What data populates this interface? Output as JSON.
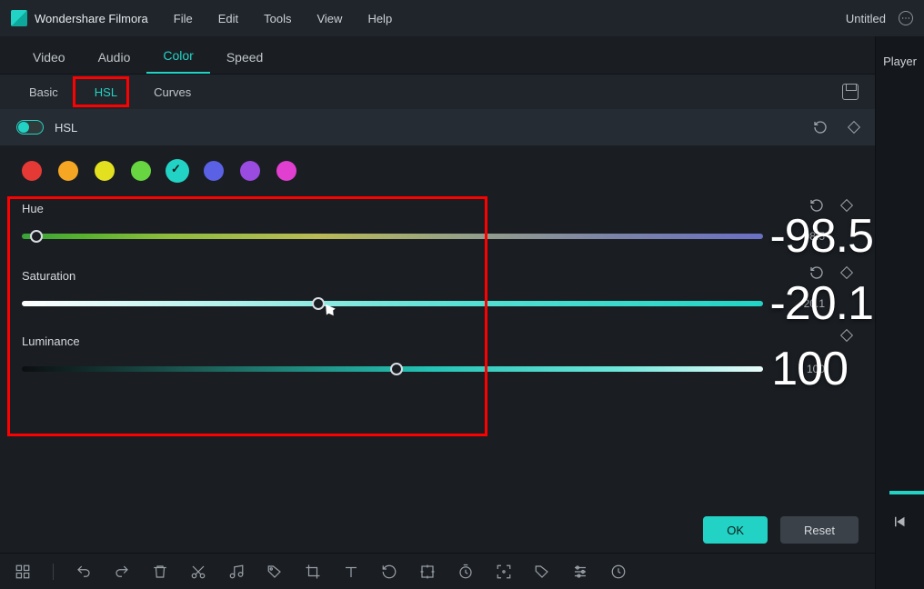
{
  "titlebar": {
    "app_name": "Wondershare Filmora",
    "menu": [
      "File",
      "Edit",
      "Tools",
      "View",
      "Help"
    ],
    "project": "Untitled"
  },
  "tabs": {
    "items": [
      "Video",
      "Audio",
      "Color",
      "Speed"
    ],
    "active": "Color"
  },
  "subtabs": {
    "items": [
      "Basic",
      "HSL",
      "Curves"
    ],
    "active": "HSL"
  },
  "hsl_section": {
    "label": "HSL",
    "enabled": true
  },
  "swatches": [
    {
      "name": "red",
      "color": "#e53935"
    },
    {
      "name": "orange",
      "color": "#f5a623"
    },
    {
      "name": "yellow",
      "color": "#e3e020"
    },
    {
      "name": "green",
      "color": "#67d640"
    },
    {
      "name": "aqua",
      "color": "#22d3c5",
      "selected": true
    },
    {
      "name": "blue",
      "color": "#5b61e5"
    },
    {
      "name": "purple",
      "color": "#9a4be0"
    },
    {
      "name": "magenta",
      "color": "#e13fd0"
    }
  ],
  "sliders": {
    "hue": {
      "label": "Hue",
      "value": "-98.5",
      "pos_percent": 2
    },
    "saturation": {
      "label": "Saturation",
      "value": "-20.1",
      "pos_percent": 40
    },
    "luminance": {
      "label": "Luminance",
      "value": "100",
      "pos_percent": 50.5
    }
  },
  "big_values": {
    "hue": "-98.5",
    "saturation": "-20.1",
    "luminance": "100"
  },
  "buttons": {
    "ok": "OK",
    "reset": "Reset"
  },
  "right_panel": {
    "tab": "Player"
  }
}
